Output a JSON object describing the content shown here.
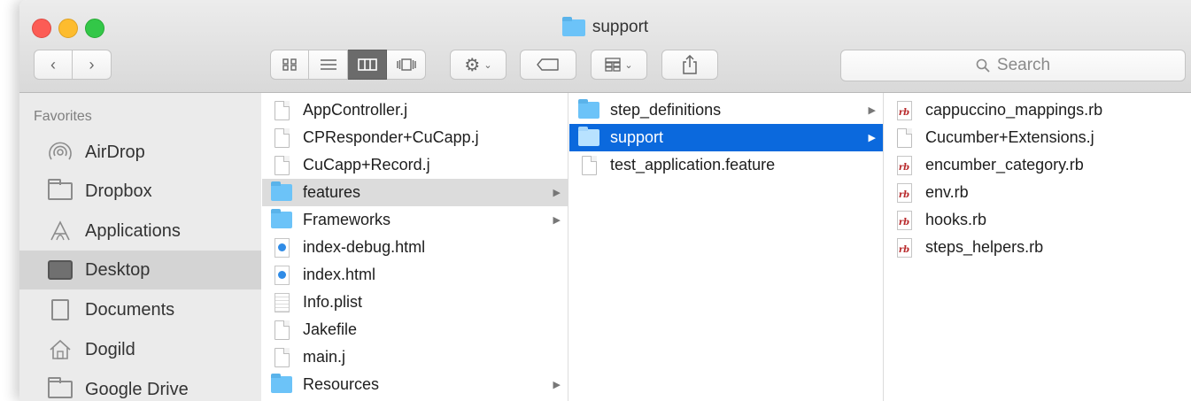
{
  "window": {
    "title": "support"
  },
  "toolbar": {
    "back_icon": "chevron-left-icon",
    "forward_icon": "chevron-right-icon",
    "views": [
      "icon-view",
      "list-view",
      "column-view",
      "cover-flow-view"
    ],
    "active_view": "column-view",
    "action_icon": "gear-icon",
    "tag_icon": "tag-icon",
    "arrange_icon": "arrange-grid-icon",
    "share_icon": "share-icon"
  },
  "search": {
    "placeholder": "Search"
  },
  "sidebar": {
    "section": "Favorites",
    "items": [
      {
        "label": "AirDrop",
        "icon": "airdrop-icon"
      },
      {
        "label": "Dropbox",
        "icon": "folder-icon"
      },
      {
        "label": "Applications",
        "icon": "applications-icon"
      },
      {
        "label": "Desktop",
        "icon": "desktop-icon",
        "active": true
      },
      {
        "label": "Documents",
        "icon": "documents-icon"
      },
      {
        "label": "Dogild",
        "icon": "home-icon"
      },
      {
        "label": "Google Drive",
        "icon": "folder-icon"
      }
    ]
  },
  "columns": [
    {
      "items": [
        {
          "name": "AppController.j",
          "type": "file"
        },
        {
          "name": "CPResponder+CuCapp.j",
          "type": "file"
        },
        {
          "name": "CuCapp+Record.j",
          "type": "file"
        },
        {
          "name": "features",
          "type": "folder",
          "state": "highlighted"
        },
        {
          "name": "Frameworks",
          "type": "folder"
        },
        {
          "name": "index-debug.html",
          "type": "html"
        },
        {
          "name": "index.html",
          "type": "html"
        },
        {
          "name": "Info.plist",
          "type": "plist"
        },
        {
          "name": "Jakefile",
          "type": "file"
        },
        {
          "name": "main.j",
          "type": "file"
        },
        {
          "name": "Resources",
          "type": "folder"
        }
      ]
    },
    {
      "items": [
        {
          "name": "step_definitions",
          "type": "folder"
        },
        {
          "name": "support",
          "type": "folder",
          "state": "selected"
        },
        {
          "name": "test_application.feature",
          "type": "file"
        }
      ]
    },
    {
      "items": [
        {
          "name": "cappuccino_mappings.rb",
          "type": "rb"
        },
        {
          "name": "Cucumber+Extensions.j",
          "type": "file"
        },
        {
          "name": "encumber_category.rb",
          "type": "rb"
        },
        {
          "name": "env.rb",
          "type": "rb"
        },
        {
          "name": "hooks.rb",
          "type": "rb"
        },
        {
          "name": "steps_helpers.rb",
          "type": "rb"
        }
      ]
    }
  ],
  "colors": {
    "selection": "#0b69dd",
    "highlight": "#dcdcdc",
    "folder": "#6cc3f8",
    "ruby": "#b8282a"
  }
}
